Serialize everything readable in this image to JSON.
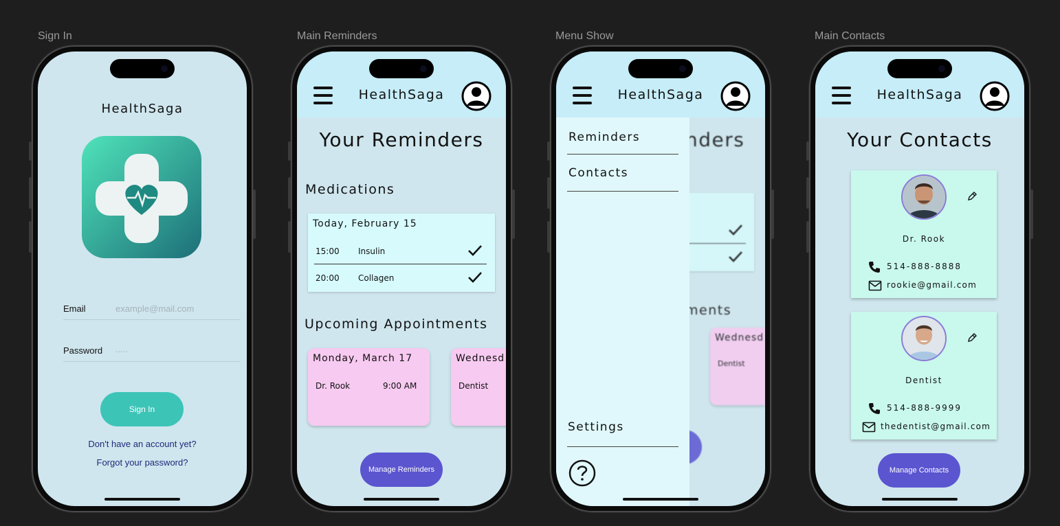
{
  "frames": {
    "signin": "Sign In",
    "reminders": "Main Reminders",
    "menu": "Menu Show",
    "contacts": "Main Contacts"
  },
  "app_name": "HealthSaga",
  "signin": {
    "email_label": "Email",
    "email_placeholder": "example@mail.com",
    "password_label": "Password",
    "password_placeholder": ".....",
    "signin_button": "Sign In",
    "signup_link": "Don't have an account yet?",
    "forgot_link": "Forgot your password?"
  },
  "reminders": {
    "heading": "Your Reminders",
    "medications_heading": "Medications",
    "med_date": "Today, February 15",
    "medications": [
      {
        "time": "15:00",
        "name": "Insulin",
        "done": true
      },
      {
        "time": "20:00",
        "name": "Collagen",
        "done": true
      }
    ],
    "appointments_heading": "Upcoming Appointments",
    "appointments": [
      {
        "date": "Monday, March 17",
        "who": "Dr. Rook",
        "time": "9:00 AM"
      },
      {
        "date": "Wednesd",
        "who": "Dentist",
        "time": ""
      }
    ],
    "manage_button": "Manage Reminders"
  },
  "menu": {
    "items": [
      "Reminders",
      "Contacts"
    ],
    "settings": "Settings",
    "help_icon": "question-circle-icon",
    "bg_heading_fragment": "nders",
    "bg_section_fragment": "ments",
    "bg_appt_fragment": "Wednesd",
    "bg_appt_who": "Dentist"
  },
  "contacts": {
    "heading": "Your Contacts",
    "people": [
      {
        "name": "Dr. Rook",
        "phone": "514-888-8888",
        "email": "rookie@gmail.com"
      },
      {
        "name": "Dentist",
        "phone": "514-888-9999",
        "email": "thedentist@gmail.com"
      }
    ],
    "manage_button": "Manage Contacts"
  },
  "colors": {
    "screen_bg": "#cfe6ee",
    "appbar": "#c6edf8",
    "med_card": "#d7fbfd",
    "appt_card": "#f7caf1",
    "contact_card": "#c9f8ec",
    "primary_button": "#5b55d0",
    "signin_button": "#3cc4b7"
  }
}
